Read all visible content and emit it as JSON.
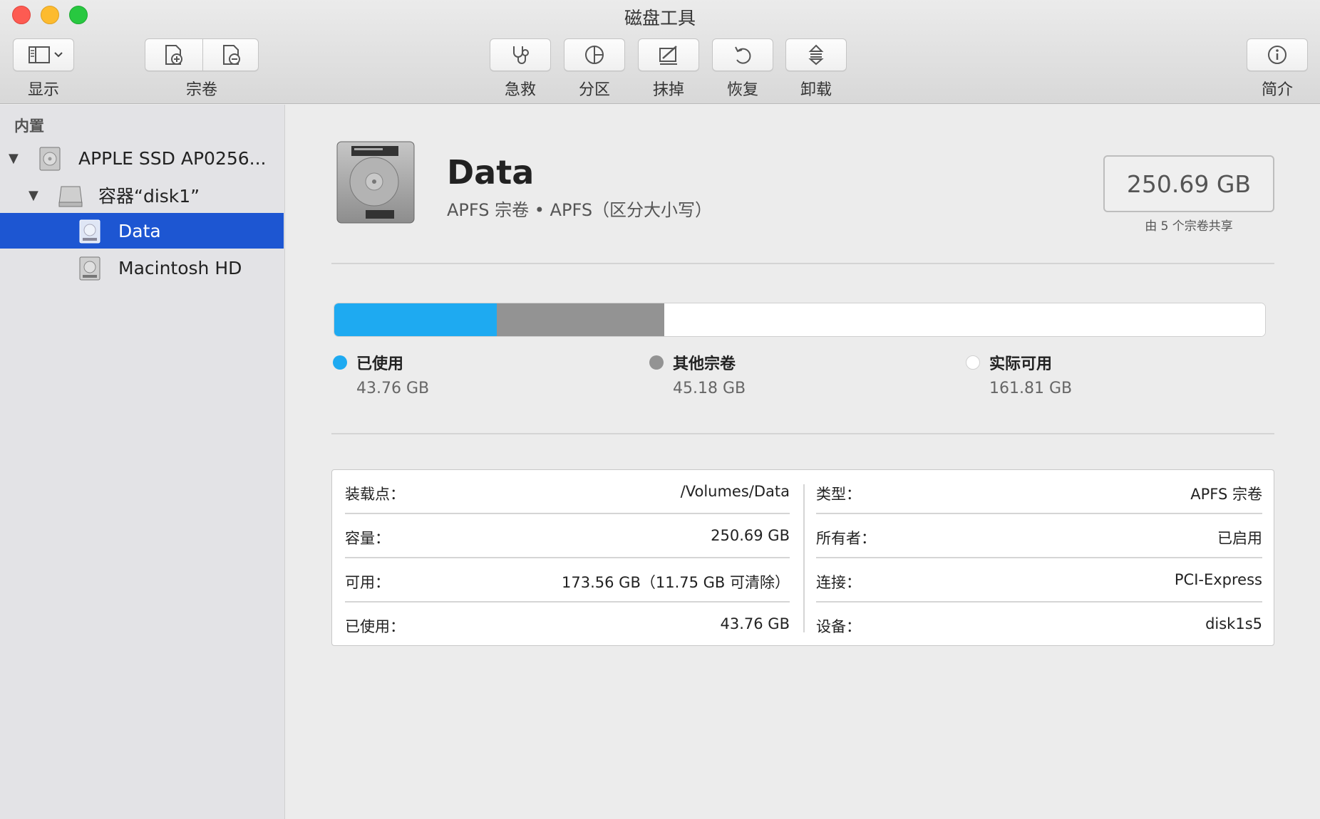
{
  "window": {
    "title": "磁盘工具"
  },
  "toolbar": {
    "view_label": "显示",
    "volume_label": "宗卷",
    "first_aid_label": "急救",
    "partition_label": "分区",
    "erase_label": "抹掉",
    "restore_label": "恢复",
    "unmount_label": "卸载",
    "info_label": "简介"
  },
  "sidebar": {
    "section": "内置",
    "items": [
      {
        "label": "APPLE SSD AP0256..."
      },
      {
        "label": "容器“disk1”"
      },
      {
        "label": "Data"
      },
      {
        "label": "Macintosh HD"
      }
    ]
  },
  "volume": {
    "name": "Data",
    "subtitle": "APFS 宗卷 • APFS（区分大小写）",
    "capacity": "250.69 GB",
    "shared_note": "由 5 个宗卷共享"
  },
  "usage": {
    "used_fraction": 0.1746,
    "other_fraction": 0.1802,
    "used_color": "#1eaaf1",
    "other_color": "#939393",
    "free_color": "#ffffff",
    "legend": [
      {
        "name": "已使用",
        "value": "43.76 GB"
      },
      {
        "name": "其他宗卷",
        "value": "45.18 GB"
      },
      {
        "name": "实际可用",
        "value": "161.81 GB"
      }
    ]
  },
  "info": {
    "left": [
      {
        "key": "装载点：",
        "value": "/Volumes/Data"
      },
      {
        "key": "容量：",
        "value": "250.69 GB"
      },
      {
        "key": "可用：",
        "value": "173.56 GB（11.75 GB 可清除）"
      },
      {
        "key": "已使用：",
        "value": "43.76 GB"
      }
    ],
    "right": [
      {
        "key": "类型：",
        "value": "APFS 宗卷"
      },
      {
        "key": "所有者：",
        "value": "已启用"
      },
      {
        "key": "连接：",
        "value": "PCI-Express"
      },
      {
        "key": "设备：",
        "value": "disk1s5"
      }
    ]
  }
}
